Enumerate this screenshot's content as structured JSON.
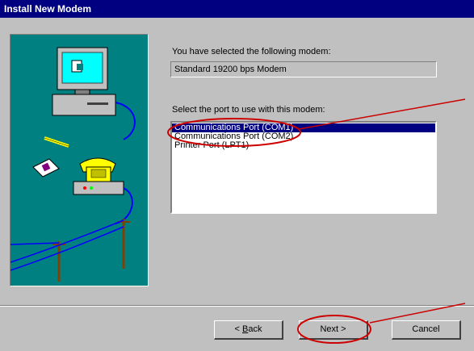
{
  "window": {
    "title": "Install New Modem"
  },
  "main": {
    "selected_modem_label": "You have selected the following modem:",
    "selected_modem_value": "Standard 19200 bps Modem",
    "port_label": "Select the port to use with this modem:",
    "ports": [
      "Communications Port (COM1)",
      "Communications Port (COM2)",
      "Printer Port (LPT1)"
    ],
    "selected_port_index": 0
  },
  "buttons": {
    "back_prefix": "< ",
    "back_mnemonic": "B",
    "back_rest": "ack",
    "next": "Next >",
    "cancel": "Cancel"
  },
  "colors": {
    "titlebar": "#000080",
    "dialog_face": "#c0c0c0",
    "illustration_bg": "#008080",
    "selection": "#000080",
    "annotation": "#cc0000"
  },
  "icons": {
    "illustration": "computer-telephone-modem-illustration"
  }
}
